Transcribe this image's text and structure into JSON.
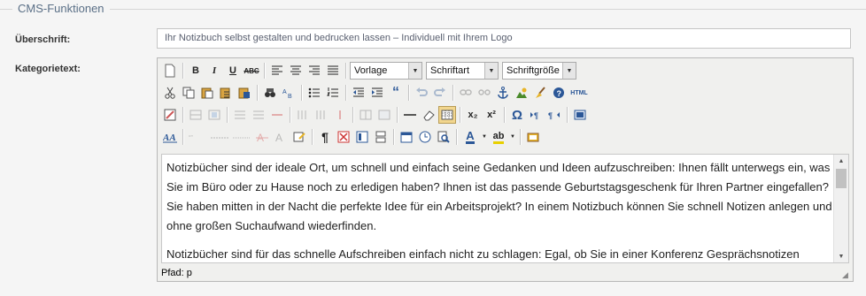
{
  "fieldset": {
    "legend": "CMS-Funktionen"
  },
  "fields": {
    "heading_label": "Überschrift:",
    "heading_value": "Ihr Notizbuch selbst gestalten und bedrucken lassen – Individuell mit Ihrem Logo",
    "category_label": "Kategorietext:"
  },
  "editor": {
    "format_select": "Vorlage",
    "font_select": "Schriftart",
    "size_select": "Schriftgröße",
    "paragraphs": [
      "Notizbücher sind der ideale Ort, um schnell und einfach seine Gedanken und Ideen aufzuschreiben: Ihnen fällt unterwegs ein, was Sie im Büro oder zu Hause noch zu erledigen haben? Ihnen ist das passende Geburtstagsgeschenk für Ihren Partner eingefallen? Sie haben mitten in der Nacht die perfekte Idee für ein Arbeitsprojekt? In einem Notizbuch können Sie schnell Notizen anlegen und ohne großen Suchaufwand wiederfinden.",
      "Notizbücher sind für das schnelle Aufschreiben einfach nicht zu schlagen: Egal, ob Sie in einer Konferenz Gesprächsnotizen"
    ],
    "path_text": "Pfad: p",
    "buttons": {
      "bold": "B",
      "italic": "I",
      "underline": "U",
      "strike": "ABC",
      "quote": "“",
      "sub": "x₂",
      "sup": "x²",
      "omega": "Ω",
      "html": "HTML",
      "font_color": "A",
      "bg_color": "ab"
    }
  },
  "colors": {
    "legend": "#5a6f86",
    "active_button": "#f2d68e",
    "toolbar_bg": "#f0f0ee"
  }
}
